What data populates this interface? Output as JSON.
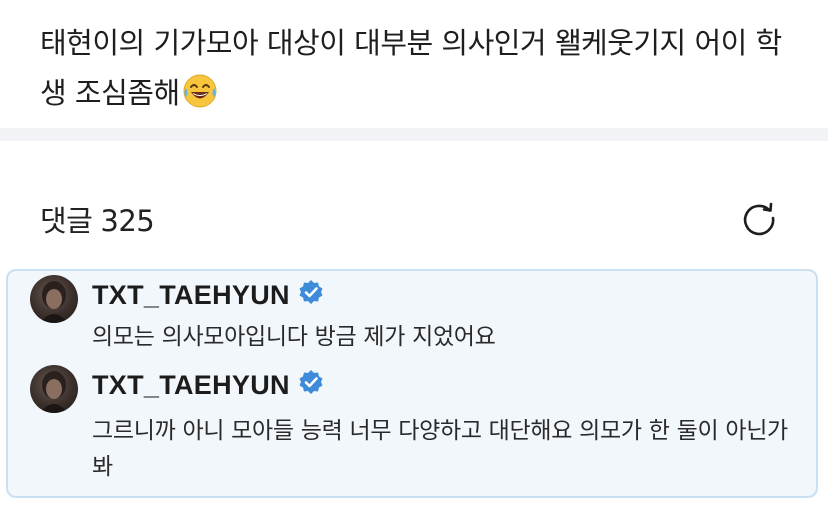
{
  "post": {
    "text": "태현이의 기가모아 대상이 대부분 의사인거 왤케웃기지 어이 학생 조심좀해",
    "emoji": "laughing-tears-emoji"
  },
  "comments": {
    "label": "댓글",
    "count": "325",
    "refresh_icon": "refresh-icon"
  },
  "thread": [
    {
      "author": "TXT_TAEHYUN",
      "verified": true,
      "text": "의모는 의사모아입니다 방금 제가 지었어요"
    },
    {
      "author": "TXT_TAEHYUN",
      "verified": true,
      "text": "그르니까 아니 모아들 능력 너무 다양하고 대단해요 의모가 한 둘이 아닌가봐"
    }
  ],
  "colors": {
    "verified": "#3d8bd9",
    "thread_bg": "#f2f7fc",
    "thread_border": "#c9dff2",
    "divider": "#f2f3f7"
  }
}
